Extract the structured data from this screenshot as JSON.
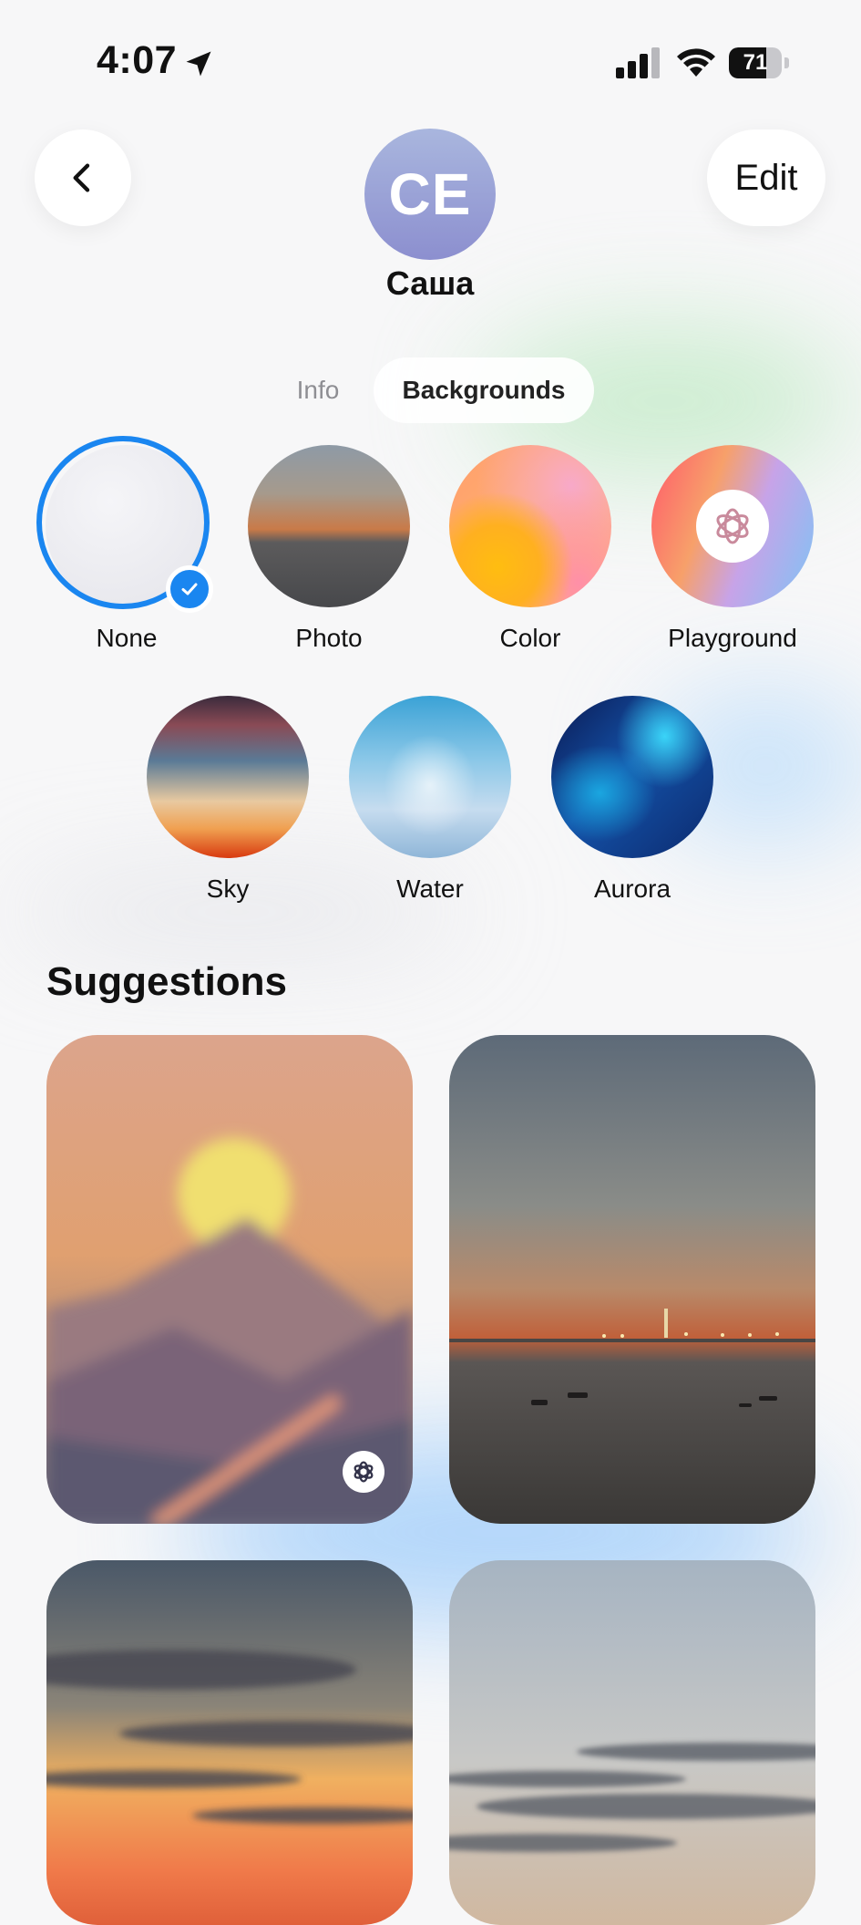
{
  "status_bar": {
    "time": "4:07",
    "battery_level": "71",
    "battery_fraction": 0.71
  },
  "header": {
    "back_icon": "chevron-left-icon",
    "edit_label": "Edit",
    "avatar_initials": "CE",
    "contact_name": "Саша"
  },
  "tabs": [
    {
      "label": "Info",
      "selected": false
    },
    {
      "label": "Backgrounds",
      "selected": true
    }
  ],
  "background_options": [
    {
      "label": "None",
      "selected": true
    },
    {
      "label": "Photo",
      "selected": false
    },
    {
      "label": "Color",
      "selected": false
    },
    {
      "label": "Playground",
      "selected": false,
      "icon": "playground-icon"
    },
    {
      "label": "Sky",
      "selected": false
    },
    {
      "label": "Water",
      "selected": false
    },
    {
      "label": "Aurora",
      "selected": false
    }
  ],
  "suggestions": {
    "title": "Suggestions",
    "items": [
      {
        "kind": "playground-sunset-mountains",
        "badge_icon": "playground-icon"
      },
      {
        "kind": "photo-sea-sunset"
      },
      {
        "kind": "photo-cloudy-sunset"
      },
      {
        "kind": "photo-sky-clouds"
      }
    ]
  },
  "colors": {
    "accent": "#1a86f0",
    "avatar_top": "#a9b6de",
    "avatar_bottom": "#8c8fcf",
    "page_background": "#f7f7f8"
  }
}
